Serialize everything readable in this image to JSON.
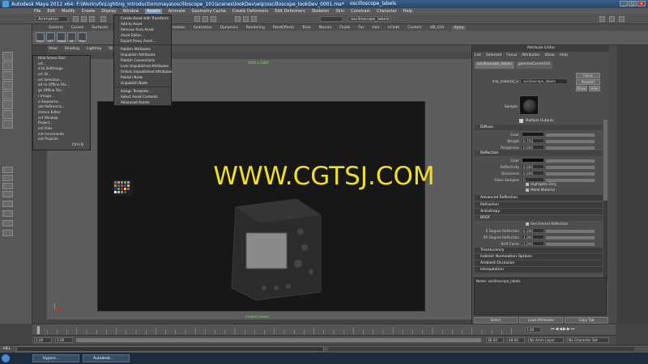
{
  "window": {
    "title": "Autodesk Maya 2012 x64: F:\\Work\\vfx\\Lighting_Introduction\\maya\\oscilloscope_101\\scenes\\lookDev\\wip\\oscilloscope_lookDev_0001.ma*",
    "node_field": "oscilloscope_labels"
  },
  "menubar": [
    "File",
    "Edit",
    "Modify",
    "Create",
    "Display",
    "Window",
    "Assets",
    "Animate",
    "Geometry Cache",
    "Create Deformers",
    "Edit Deformers",
    "Skeleton",
    "Skin",
    "Constrain",
    "Character",
    "Help"
  ],
  "mode_select": "Animation",
  "shelf_tabs": [
    "General",
    "Curves",
    "Surfaces",
    "Polygons",
    "Subdivs",
    "Deformation",
    "Animation",
    "Dynamics",
    "Rendering",
    "PaintEffects",
    "Toon",
    "Muscle",
    "Fluids",
    "Fur",
    "Hair",
    "nCloth",
    "Custom",
    "stB_GUI",
    "Kairo"
  ],
  "shelf_buttons": [
    "Oscil",
    "GTT",
    "Mdlbd",
    "SE",
    "Plan"
  ],
  "assets_menu": {
    "items": [
      "Create Asset with Transform",
      "Add to Asset",
      "Remove from Asset",
      "Asset Editor...",
      "Export Proxy Asset...",
      "Publish Attributes",
      "Unpublish Attributes",
      "Publish Connections",
      "Lock Unpublished Attributes",
      "Unlock Unpublished Attributes",
      "Publish Node",
      "Unpublish Node",
      "Assign Template...",
      "Select Asset Contents",
      "Advanced Assets"
    ]
  },
  "context_menu": {
    "items": [
      "Hide Scene Size",
      "ort...",
      "d to Softimage",
      "ort All...",
      "ort Selection...",
      "ort to Offline File...",
      "gn Offline File...",
      "r Image...",
      "e Sequence...",
      "ate Reference...",
      "erence Editor",
      "ect Window",
      "Project...",
      "ent Files",
      "ent Increments",
      "ent Projects",
      "Ctrl+Q"
    ]
  },
  "panel_menu": [
    "View",
    "Shading",
    "Lighting",
    "Show",
    "Rende"
  ],
  "viewport": {
    "resolution_label": "1920 x 1080",
    "camera_label": "renderCamera"
  },
  "watermark": "WWW.CGTSJ.COM",
  "attribute_editor": {
    "title": "Attribute Editor",
    "menu": [
      "List",
      "Selected",
      "Focus",
      "Attributes",
      "Show",
      "Help"
    ],
    "tabs": [
      "oscilloscope_labels",
      "gammaCorrect14"
    ],
    "material_label": "mia_material_x:",
    "material_value": "oscilloscope_labels",
    "focus_button": "Focus",
    "presets_button": "Presets*",
    "show_button": "Show",
    "hide_button": "Hide",
    "sample_label": "Sample",
    "multiple_outputs": "Multiple Outputs",
    "sections": {
      "diffuse": "Diffuse",
      "reflection": "Reflection",
      "advanced_reflection": "Advanced Reflection",
      "refraction": "Refraction",
      "anisotropy": "Anisotropy",
      "brdf": "BRDF",
      "translucency": "Translucency",
      "indirect": "Indirect Illumination Options",
      "ao": "Ambient Occlusion",
      "interpolation": "Interpolation"
    },
    "diffuse_rows": [
      {
        "label": "Color",
        "value": ""
      },
      {
        "label": "Weight",
        "value": "0.750"
      },
      {
        "label": "Roughness",
        "value": "0.000"
      }
    ],
    "reflection_rows": [
      {
        "label": "Color",
        "value": ""
      },
      {
        "label": "Reflectivity",
        "value": "0.000"
      },
      {
        "label": "Glossiness",
        "value": "0.000"
      },
      {
        "label": "Gloss Samples",
        "value": "0"
      }
    ],
    "highlights_only": "Highlights Only",
    "metal_material": "Metal Material",
    "use_fresnel": "Use Fresnel Reflection",
    "brdf_rows": [
      {
        "label": "0 Degree Reflection",
        "value": "0.200"
      },
      {
        "label": "90 Degree Reflection",
        "value": "1.000"
      },
      {
        "label": "Brdf Curve",
        "value": "5.000"
      }
    ],
    "notes": "Notes: oscilloscope_labels",
    "bottom_buttons": [
      "Select",
      "Load Attributes",
      "Copy Tab"
    ]
  },
  "timeline": {
    "start_field": "1.00",
    "current_field": "1.00",
    "range_start": "1.00",
    "range_end": "36.00",
    "end_field": "48.00",
    "current_frame": "1.00",
    "anim_layer": "No Anim Layer",
    "character_set": "No Character Set"
  },
  "command_line": {
    "label": "MEL"
  },
  "taskbar": {
    "items": [
      "Hypers...",
      "Autodesk..."
    ]
  },
  "colors": {
    "accent": "#6b8fb8",
    "viewport_bg": "#5d5d5d",
    "resgate_bg": "#171717",
    "watermark": "#f0e020"
  }
}
